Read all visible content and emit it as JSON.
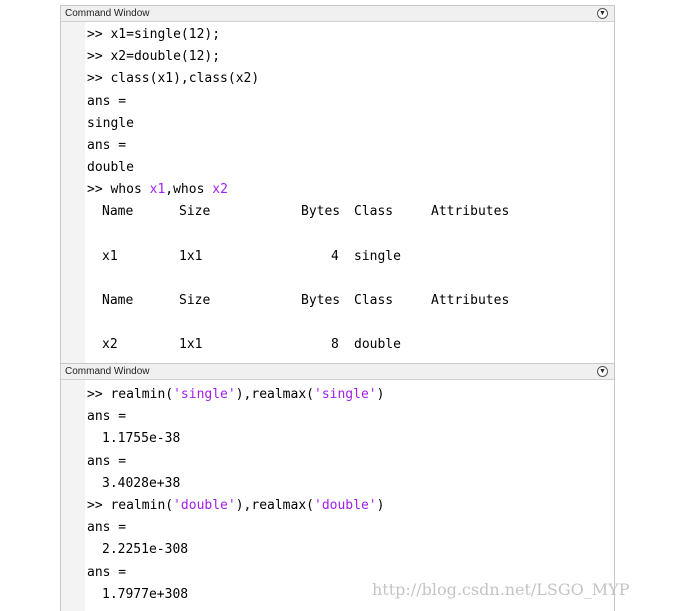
{
  "window_title": "Command Window",
  "panel1": {
    "cmd1": ">> x1=single(12);",
    "cmd2": ">> x2=double(12);",
    "cmd3": ">> class(x1),class(x2)",
    "ans1": "ans =",
    "val1": "single",
    "ans2": "ans =",
    "val2": "double",
    "cmd4_pre": ">> whos ",
    "cmd4_v1": "x1",
    "cmd4_mid": ",whos ",
    "cmd4_v2": "x2",
    "table_header": {
      "name": "Name",
      "size": "Size",
      "bytes": "Bytes",
      "class": "Class",
      "attributes": "Attributes"
    },
    "rows": [
      {
        "name": "x1",
        "size": "1x1",
        "bytes": "4",
        "class": "single"
      },
      {
        "name": "x2",
        "size": "1x1",
        "bytes": "8",
        "class": "double"
      }
    ]
  },
  "panel2": {
    "cmd1_a": ">> realmin(",
    "cmd1_s1": "'single'",
    "cmd1_b": "),realmax(",
    "cmd1_s2": "'single'",
    "cmd1_c": ")",
    "ans1": "ans =",
    "val1": "1.1755e-38",
    "ans2": "ans =",
    "val2": "3.4028e+38",
    "cmd2_a": ">> realmin(",
    "cmd2_s1": "'double'",
    "cmd2_b": "),realmax(",
    "cmd2_s2": "'double'",
    "cmd2_c": ")",
    "ans3": "ans =",
    "val3": "2.2251e-308",
    "ans4": "ans =",
    "val4": "1.7977e+308"
  },
  "watermark": "http://blog.csdn.net/LSGO_MYP"
}
